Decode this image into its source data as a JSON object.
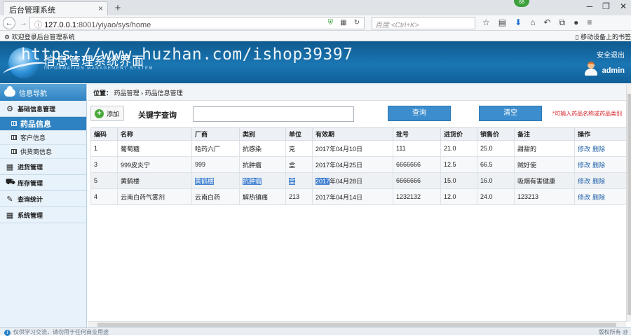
{
  "browser": {
    "tab_title": "后台管理系统",
    "tab_close": "×",
    "new_tab": "+",
    "badge": "68",
    "url_host": "127.0.0.1",
    "url_path": ":8001/yiyao/sys/home",
    "search_placeholder": "百度 <Ctrl+K>",
    "bookmark_left": "欢迎登录后台管理系统",
    "bookmark_right": "移动设备上的书签"
  },
  "header": {
    "system_title": "信息管理系统界面",
    "system_subtitle": "INFORMATION MANAGEMENT SYSTEM",
    "watermark": "https://www.huzhan.com/ishop39397",
    "logout": "安全退出",
    "username": "admin"
  },
  "sidebar": {
    "nav_title": "信息导航",
    "group_basic": "基础信息管理",
    "items": [
      {
        "label": "药品信息"
      },
      {
        "label": "客户信息"
      },
      {
        "label": "供货商信息"
      }
    ],
    "group_purchase": "进货管理",
    "group_stock": "库存管理",
    "group_query": "查询统计",
    "group_system": "系统管理"
  },
  "breadcrumb": {
    "prefix": "位置：",
    "level1": "药品管理",
    "separator": "›",
    "level2": "药品信息管理"
  },
  "toolbar": {
    "add_label": "添加",
    "keyword_label": "关键字查询",
    "keyword_value": "",
    "query_label": "查询",
    "clear_label": "清空",
    "hint": "*可输入药品名称或药品类别"
  },
  "table": {
    "headers": [
      "编码",
      "名称",
      "厂商",
      "类别",
      "单位",
      "有效期",
      "批号",
      "进货价",
      "销售价",
      "备注",
      "操作"
    ],
    "edit_label": "修改",
    "delete_label": "删除",
    "rows": [
      {
        "code": "1",
        "name": "葡萄糖",
        "maker": "哈药六厂",
        "category": "抗感染",
        "unit": "克",
        "expiry": "2017年04月10日",
        "batch": "111",
        "buy": "21.0",
        "sell": "25.0",
        "note": "甜甜的"
      },
      {
        "code": "3",
        "name": "999皮炎宁",
        "maker": "999",
        "category": "抗肿瘤",
        "unit": "盒",
        "expiry": "2017年04月25日",
        "batch": "6666666",
        "buy": "12.5",
        "sell": "66.5",
        "note": "贼好使"
      },
      {
        "code": "5",
        "name": "黄鹤楼",
        "maker": "黄鹤楼",
        "category": "抗肿瘤",
        "unit": "盒",
        "expiry_sel": "2017",
        "expiry_rest": "年04月28日",
        "batch": "6666666",
        "buy": "15.0",
        "sell": "16.0",
        "note": "吸烟有害健康"
      },
      {
        "code": "4",
        "name": "云南白药气雾剂",
        "maker": "云南白药",
        "category": "解热镇痛",
        "unit": "213",
        "expiry": "2017年04月14日",
        "batch": "1232132",
        "buy": "12.0",
        "sell": "24.0",
        "note": "123213"
      }
    ]
  },
  "footer": {
    "info": "仅供学习交流，请勿用于任何商业用途",
    "copyright": "版权所有 @"
  }
}
